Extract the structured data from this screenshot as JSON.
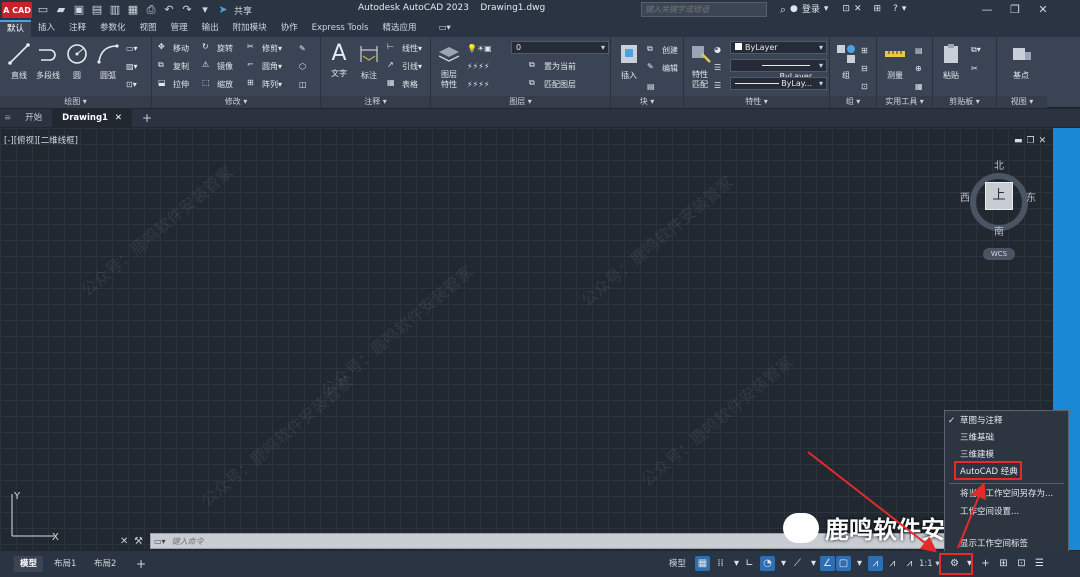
{
  "titlebar": {
    "logo": "A CAD",
    "share": "共享",
    "title": "Autodesk AutoCAD 2023    Drawing1.dwg",
    "search_placeholder": "键入关键字或短语",
    "login": "登录"
  },
  "ribbon_tabs": [
    "默认",
    "插入",
    "注释",
    "参数化",
    "视图",
    "管理",
    "输出",
    "附加模块",
    "协作",
    "Express Tools",
    "精选应用"
  ],
  "ribbon": {
    "draw": {
      "panel": "绘图",
      "line": "直线",
      "polyline": "多段线",
      "circle": "圆",
      "arc": "圆弧"
    },
    "modify": {
      "panel": "修改",
      "move": "移动",
      "rotate": "旋转",
      "trim": "修剪",
      "copy": "复制",
      "mirror": "镜像",
      "fillet": "圆角",
      "stretch": "拉伸",
      "scale": "缩放",
      "array": "阵列"
    },
    "annotation": {
      "panel": "注释",
      "text": "文字",
      "dimension": "标注",
      "linear": "线性",
      "leader": "引线",
      "table": "表格"
    },
    "layers": {
      "panel": "图层",
      "properties_line1": "图层",
      "properties_line2": "特性",
      "current_layer": "0",
      "make_current": "置为当前",
      "match_layer": "匹配图层"
    },
    "block": {
      "panel": "块",
      "insert": "插入",
      "create": "创建",
      "edit": "编辑"
    },
    "properties": {
      "panel": "特性",
      "match_line1": "特性",
      "match_line2": "匹配",
      "color": "ByLayer",
      "linetype": "ByLayer",
      "lineweight": "ByLay..."
    },
    "groups": {
      "panel": "组",
      "group": "组"
    },
    "utilities": {
      "panel": "实用工具",
      "measure": "测量"
    },
    "clipboard": {
      "panel": "剪贴板",
      "paste": "粘贴"
    },
    "view": {
      "panel": "视图",
      "base": "基点"
    }
  },
  "file_tabs": [
    "开始",
    "Drawing1"
  ],
  "viewport_label": "[-][俯视][二维线框]",
  "viewcube": {
    "north": "北",
    "south": "南",
    "east": "东",
    "west": "西",
    "face": "上",
    "wcs": "WCS"
  },
  "command_placeholder": "键入命令",
  "layout_tabs": [
    "模型",
    "布局1",
    "布局2"
  ],
  "status": {
    "model": "模型",
    "scale": "1:1"
  },
  "workspace_menu": {
    "items": [
      "草图与注释",
      "三维基础",
      "三维建模",
      "AutoCAD 经典",
      "将当前工作空间另存为...",
      "工作空间设置...",
      "显示工作空间标签"
    ],
    "checked": "草图与注释"
  },
  "watermark": {
    "text": "鹿鸣软件安装管家",
    "faint": "公众号：鹿鸣软件安装管家"
  },
  "colors": {
    "highlight_box": "#e42a2a",
    "scrollbar": "#1b88d6",
    "canvas": "#212830"
  }
}
